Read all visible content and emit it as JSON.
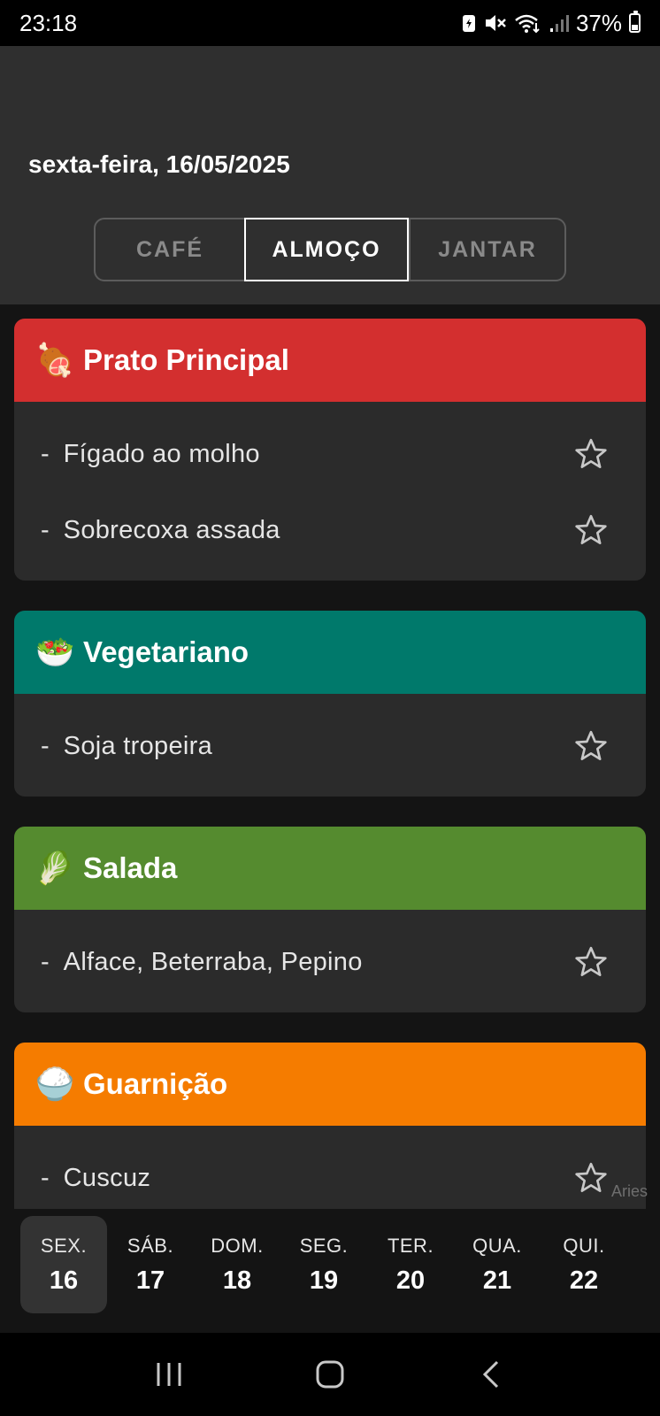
{
  "status_bar": {
    "time": "23:18",
    "battery_percent": "37%",
    "icons": [
      "battery-saver-icon",
      "mute-icon",
      "wifi-icon",
      "signal-icon",
      "battery-icon"
    ]
  },
  "header": {
    "date": "sexta-feira, 16/05/2025",
    "tabs": [
      {
        "label": "CAFÉ",
        "selected": false
      },
      {
        "label": "ALMOÇO",
        "selected": true
      },
      {
        "label": "JANTAR",
        "selected": false
      }
    ]
  },
  "colors": {
    "prato_principal": "#d32f2f",
    "vegetariano": "#00796b",
    "salada": "#558b2f",
    "guarnicao": "#f57c00",
    "card_bg": "#2b2b2b",
    "header_bg": "#2f2f2f"
  },
  "sections": [
    {
      "icon": "🍖",
      "icon_name": "meat-icon",
      "title": "Prato Principal",
      "color": "#d32f2f",
      "items": [
        {
          "label": "Fígado ao molho"
        },
        {
          "label": "Sobrecoxa assada"
        }
      ]
    },
    {
      "icon": "🥗",
      "icon_name": "salad-bowl-icon",
      "title": "Vegetariano",
      "color": "#00796b",
      "items": [
        {
          "label": "Soja tropeira"
        }
      ]
    },
    {
      "icon": "🥬",
      "icon_name": "leafy-green-icon",
      "title": "Salada",
      "color": "#558b2f",
      "items": [
        {
          "label": "Alface, Beterraba, Pepino"
        }
      ]
    },
    {
      "icon": "🍚",
      "icon_name": "rice-icon",
      "title": "Guarnição",
      "color": "#f57c00",
      "items": [
        {
          "label": "Cuscuz"
        }
      ]
    }
  ],
  "item_dash": "-",
  "watermark": "Aries",
  "days": [
    {
      "name": "SEX.",
      "num": "16",
      "selected": true
    },
    {
      "name": "SÁB.",
      "num": "17",
      "selected": false
    },
    {
      "name": "DOM.",
      "num": "18",
      "selected": false
    },
    {
      "name": "SEG.",
      "num": "19",
      "selected": false
    },
    {
      "name": "TER.",
      "num": "20",
      "selected": false
    },
    {
      "name": "QUA.",
      "num": "21",
      "selected": false
    },
    {
      "name": "QUI.",
      "num": "22",
      "selected": false
    }
  ]
}
